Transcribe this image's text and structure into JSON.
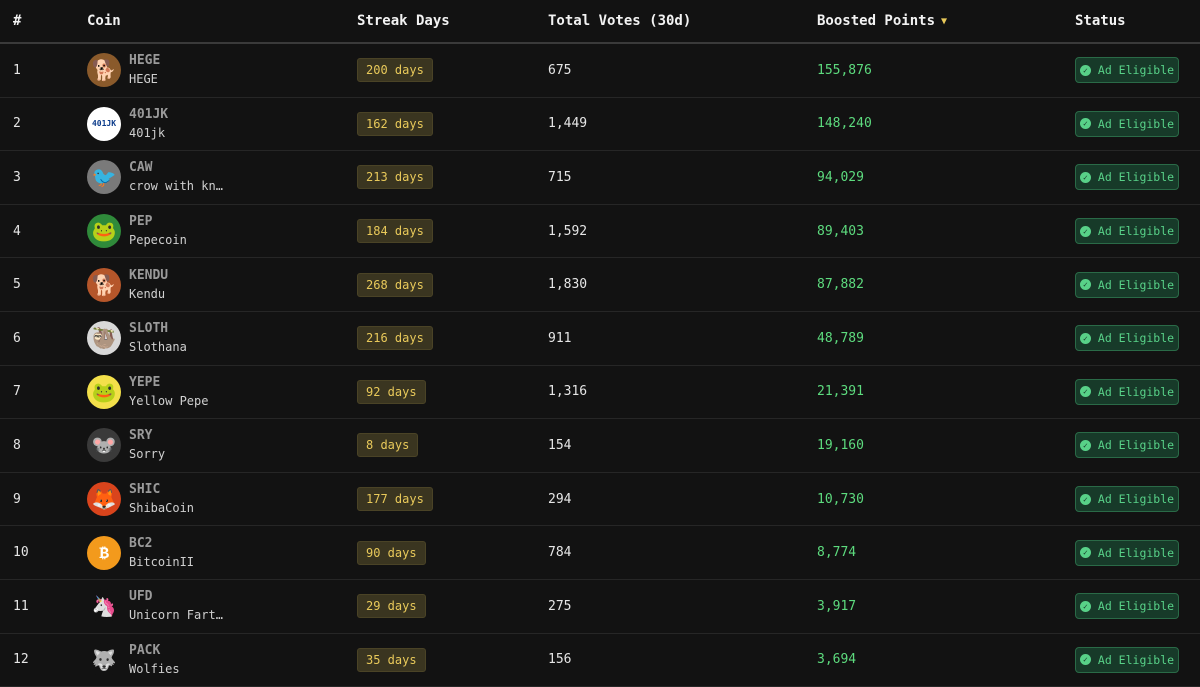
{
  "header": {
    "rank": "#",
    "coin": "Coin",
    "streak": "Streak Days",
    "votes": "Total Votes (30d)",
    "points": "Boosted Points",
    "status": "Status"
  },
  "rows": [
    {
      "rank": "1",
      "symbol": "HEGE",
      "name": "HEGE",
      "streak": "200 days",
      "votes": "675",
      "points": "155,876",
      "status": "Ad Eligible",
      "avatar_color": "#8a5a2b",
      "avatar_label": "🐕"
    },
    {
      "rank": "2",
      "symbol": "401JK",
      "name": "401jk",
      "streak": "162 days",
      "votes": "1,449",
      "points": "148,240",
      "status": "Ad Eligible",
      "avatar_color": "#ffffff",
      "avatar_label": "401JK"
    },
    {
      "rank": "3",
      "symbol": "CAW",
      "name": "crow with kn…",
      "streak": "213 days",
      "votes": "715",
      "points": "94,029",
      "status": "Ad Eligible",
      "avatar_color": "#7a7a7a",
      "avatar_label": "🐦"
    },
    {
      "rank": "4",
      "symbol": "PEP",
      "name": "Pepecoin",
      "streak": "184 days",
      "votes": "1,592",
      "points": "89,403",
      "status": "Ad Eligible",
      "avatar_color": "#2f8a3a",
      "avatar_label": "🐸"
    },
    {
      "rank": "5",
      "symbol": "KENDU",
      "name": "Kendu",
      "streak": "268 days",
      "votes": "1,830",
      "points": "87,882",
      "status": "Ad Eligible",
      "avatar_color": "#b5562a",
      "avatar_label": "🐕"
    },
    {
      "rank": "6",
      "symbol": "SLOTH",
      "name": "Slothana",
      "streak": "216 days",
      "votes": "911",
      "points": "48,789",
      "status": "Ad Eligible",
      "avatar_color": "#d8d8d8",
      "avatar_label": "🦥"
    },
    {
      "rank": "7",
      "symbol": "YEPE",
      "name": "Yellow Pepe",
      "streak": "92 days",
      "votes": "1,316",
      "points": "21,391",
      "status": "Ad Eligible",
      "avatar_color": "#f3e04a",
      "avatar_label": "🐸"
    },
    {
      "rank": "8",
      "symbol": "SRY",
      "name": "Sorry",
      "streak": "8 days",
      "votes": "154",
      "points": "19,160",
      "status": "Ad Eligible",
      "avatar_color": "#3a3a3a",
      "avatar_label": "🐭"
    },
    {
      "rank": "9",
      "symbol": "SHIC",
      "name": "ShibaCoin",
      "streak": "177 days",
      "votes": "294",
      "points": "10,730",
      "status": "Ad Eligible",
      "avatar_color": "#d9441c",
      "avatar_label": "🦊"
    },
    {
      "rank": "10",
      "symbol": "BC2",
      "name": "BitcoinII",
      "streak": "90 days",
      "votes": "784",
      "points": "8,774",
      "status": "Ad Eligible",
      "avatar_color": "#f39a1c",
      "avatar_label": "₿"
    },
    {
      "rank": "11",
      "symbol": "UFD",
      "name": "Unicorn Fart…",
      "streak": "29 days",
      "votes": "275",
      "points": "3,917",
      "status": "Ad Eligible",
      "avatar_color": "#121212",
      "avatar_label": "🦄"
    },
    {
      "rank": "12",
      "symbol": "PACK",
      "name": "Wolfies",
      "streak": "35 days",
      "votes": "156",
      "points": "3,694",
      "status": "Ad Eligible",
      "avatar_color": "#121212",
      "avatar_label": "🐺"
    }
  ],
  "colors": {
    "background": "#121212",
    "streak_text": "#e8c95a",
    "points_text": "#5ddb7e",
    "status_text": "#58d188"
  }
}
